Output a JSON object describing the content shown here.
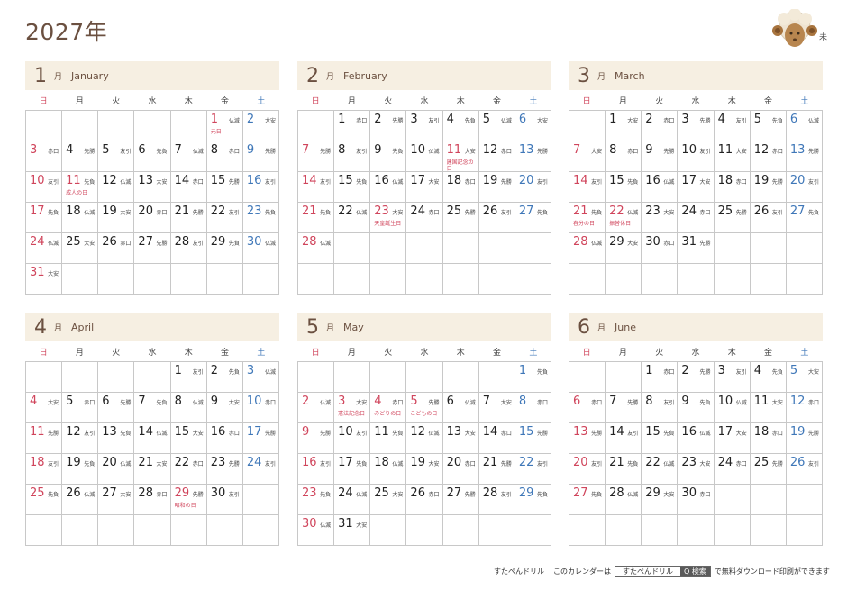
{
  "title": "2027年",
  "zodiac": "未",
  "weekdays": [
    "日",
    "月",
    "火",
    "水",
    "木",
    "金",
    "土"
  ],
  "months": [
    {
      "num": "1",
      "jp": "月",
      "en": "January",
      "offset": 5,
      "days": [
        [
          "1",
          "仏滅",
          "元日"
        ],
        [
          "2",
          "大安"
        ],
        [
          "3",
          "赤口"
        ],
        [
          "4",
          "先勝"
        ],
        [
          "5",
          "友引"
        ],
        [
          "6",
          "先負"
        ],
        [
          "7",
          "仏滅"
        ],
        [
          "8",
          "赤口"
        ],
        [
          "9",
          "先勝"
        ],
        [
          "10",
          "友引"
        ],
        [
          "11",
          "先負",
          "成人の日"
        ],
        [
          "12",
          "仏滅"
        ],
        [
          "13",
          "大安"
        ],
        [
          "14",
          "赤口"
        ],
        [
          "15",
          "先勝"
        ],
        [
          "16",
          "友引"
        ],
        [
          "17",
          "先負"
        ],
        [
          "18",
          "仏滅"
        ],
        [
          "19",
          "大安"
        ],
        [
          "20",
          "赤口"
        ],
        [
          "21",
          "先勝"
        ],
        [
          "22",
          "友引"
        ],
        [
          "23",
          "先負"
        ],
        [
          "24",
          "仏滅"
        ],
        [
          "25",
          "大安"
        ],
        [
          "26",
          "赤口"
        ],
        [
          "27",
          "先勝"
        ],
        [
          "28",
          "友引"
        ],
        [
          "29",
          "先負"
        ],
        [
          "30",
          "仏滅"
        ],
        [
          "31",
          "大安"
        ]
      ]
    },
    {
      "num": "2",
      "jp": "月",
      "en": "February",
      "offset": 1,
      "days": [
        [
          "1",
          "赤口"
        ],
        [
          "2",
          "先勝"
        ],
        [
          "3",
          "友引"
        ],
        [
          "4",
          "先負"
        ],
        [
          "5",
          "仏滅"
        ],
        [
          "6",
          "大安"
        ],
        [
          "7",
          "先勝"
        ],
        [
          "8",
          "友引"
        ],
        [
          "9",
          "先負"
        ],
        [
          "10",
          "仏滅"
        ],
        [
          "11",
          "大安",
          "建国記念の日"
        ],
        [
          "12",
          "赤口"
        ],
        [
          "13",
          "先勝"
        ],
        [
          "14",
          "友引"
        ],
        [
          "15",
          "先負"
        ],
        [
          "16",
          "仏滅"
        ],
        [
          "17",
          "大安"
        ],
        [
          "18",
          "赤口"
        ],
        [
          "19",
          "先勝"
        ],
        [
          "20",
          "友引"
        ],
        [
          "21",
          "先負"
        ],
        [
          "22",
          "仏滅"
        ],
        [
          "23",
          "大安",
          "天皇誕生日"
        ],
        [
          "24",
          "赤口"
        ],
        [
          "25",
          "先勝"
        ],
        [
          "26",
          "友引"
        ],
        [
          "27",
          "先負"
        ],
        [
          "28",
          "仏滅"
        ]
      ]
    },
    {
      "num": "3",
      "jp": "月",
      "en": "March",
      "offset": 1,
      "days": [
        [
          "1",
          "大安"
        ],
        [
          "2",
          "赤口"
        ],
        [
          "3",
          "先勝"
        ],
        [
          "4",
          "友引"
        ],
        [
          "5",
          "先負"
        ],
        [
          "6",
          "仏滅"
        ],
        [
          "7",
          "大安"
        ],
        [
          "8",
          "赤口"
        ],
        [
          "9",
          "先勝"
        ],
        [
          "10",
          "友引"
        ],
        [
          "11",
          "大安"
        ],
        [
          "12",
          "赤口"
        ],
        [
          "13",
          "先勝"
        ],
        [
          "14",
          "友引"
        ],
        [
          "15",
          "先負"
        ],
        [
          "16",
          "仏滅"
        ],
        [
          "17",
          "大安"
        ],
        [
          "18",
          "赤口"
        ],
        [
          "19",
          "先勝"
        ],
        [
          "20",
          "友引"
        ],
        [
          "21",
          "先負",
          "春分の日"
        ],
        [
          "22",
          "仏滅",
          "振替休日"
        ],
        [
          "23",
          "大安"
        ],
        [
          "24",
          "赤口"
        ],
        [
          "25",
          "先勝"
        ],
        [
          "26",
          "友引"
        ],
        [
          "27",
          "先負"
        ],
        [
          "28",
          "仏滅"
        ],
        [
          "29",
          "大安"
        ],
        [
          "30",
          "赤口"
        ],
        [
          "31",
          "先勝"
        ]
      ]
    },
    {
      "num": "4",
      "jp": "月",
      "en": "April",
      "offset": 4,
      "days": [
        [
          "1",
          "友引"
        ],
        [
          "2",
          "先負"
        ],
        [
          "3",
          "仏滅"
        ],
        [
          "4",
          "大安"
        ],
        [
          "5",
          "赤口"
        ],
        [
          "6",
          "先勝"
        ],
        [
          "7",
          "先負"
        ],
        [
          "8",
          "仏滅"
        ],
        [
          "9",
          "大安"
        ],
        [
          "10",
          "赤口"
        ],
        [
          "11",
          "先勝"
        ],
        [
          "12",
          "友引"
        ],
        [
          "13",
          "先負"
        ],
        [
          "14",
          "仏滅"
        ],
        [
          "15",
          "大安"
        ],
        [
          "16",
          "赤口"
        ],
        [
          "17",
          "先勝"
        ],
        [
          "18",
          "友引"
        ],
        [
          "19",
          "先負"
        ],
        [
          "20",
          "仏滅"
        ],
        [
          "21",
          "大安"
        ],
        [
          "22",
          "赤口"
        ],
        [
          "23",
          "先勝"
        ],
        [
          "24",
          "友引"
        ],
        [
          "25",
          "先負"
        ],
        [
          "26",
          "仏滅"
        ],
        [
          "27",
          "大安"
        ],
        [
          "28",
          "赤口"
        ],
        [
          "29",
          "先勝",
          "昭和の日"
        ],
        [
          "30",
          "友引"
        ]
      ]
    },
    {
      "num": "5",
      "jp": "月",
      "en": "May",
      "offset": 6,
      "days": [
        [
          "1",
          "先負"
        ],
        [
          "2",
          "仏滅"
        ],
        [
          "3",
          "大安",
          "憲法記念日"
        ],
        [
          "4",
          "赤口",
          "みどりの日"
        ],
        [
          "5",
          "先勝",
          "こどもの日"
        ],
        [
          "6",
          "仏滅"
        ],
        [
          "7",
          "大安"
        ],
        [
          "8",
          "赤口"
        ],
        [
          "9",
          "先勝"
        ],
        [
          "10",
          "友引"
        ],
        [
          "11",
          "先負"
        ],
        [
          "12",
          "仏滅"
        ],
        [
          "13",
          "大安"
        ],
        [
          "14",
          "赤口"
        ],
        [
          "15",
          "先勝"
        ],
        [
          "16",
          "友引"
        ],
        [
          "17",
          "先負"
        ],
        [
          "18",
          "仏滅"
        ],
        [
          "19",
          "大安"
        ],
        [
          "20",
          "赤口"
        ],
        [
          "21",
          "先勝"
        ],
        [
          "22",
          "友引"
        ],
        [
          "23",
          "先負"
        ],
        [
          "24",
          "仏滅"
        ],
        [
          "25",
          "大安"
        ],
        [
          "26",
          "赤口"
        ],
        [
          "27",
          "先勝"
        ],
        [
          "28",
          "友引"
        ],
        [
          "29",
          "先負"
        ],
        [
          "30",
          "仏滅"
        ],
        [
          "31",
          "大安"
        ]
      ]
    },
    {
      "num": "6",
      "jp": "月",
      "en": "June",
      "offset": 2,
      "days": [
        [
          "1",
          "赤口"
        ],
        [
          "2",
          "先勝"
        ],
        [
          "3",
          "友引"
        ],
        [
          "4",
          "先負"
        ],
        [
          "5",
          "大安"
        ],
        [
          "6",
          "赤口"
        ],
        [
          "7",
          "先勝"
        ],
        [
          "8",
          "友引"
        ],
        [
          "9",
          "先負"
        ],
        [
          "10",
          "仏滅"
        ],
        [
          "11",
          "大安"
        ],
        [
          "12",
          "赤口"
        ],
        [
          "13",
          "先勝"
        ],
        [
          "14",
          "友引"
        ],
        [
          "15",
          "先負"
        ],
        [
          "16",
          "仏滅"
        ],
        [
          "17",
          "大安"
        ],
        [
          "18",
          "赤口"
        ],
        [
          "19",
          "先勝"
        ],
        [
          "20",
          "友引"
        ],
        [
          "21",
          "先負"
        ],
        [
          "22",
          "仏滅"
        ],
        [
          "23",
          "大安"
        ],
        [
          "24",
          "赤口"
        ],
        [
          "25",
          "先勝"
        ],
        [
          "26",
          "友引"
        ],
        [
          "27",
          "先負"
        ],
        [
          "28",
          "仏滅"
        ],
        [
          "29",
          "大安"
        ],
        [
          "30",
          "赤口"
        ]
      ]
    }
  ],
  "footer": {
    "brand": "すたぺんドリル",
    "lead": "このカレンダーは",
    "box_text": "すたぺんドリル",
    "search_label": "Q 検索",
    "tail": "で無料ダウンロード印刷ができます"
  }
}
